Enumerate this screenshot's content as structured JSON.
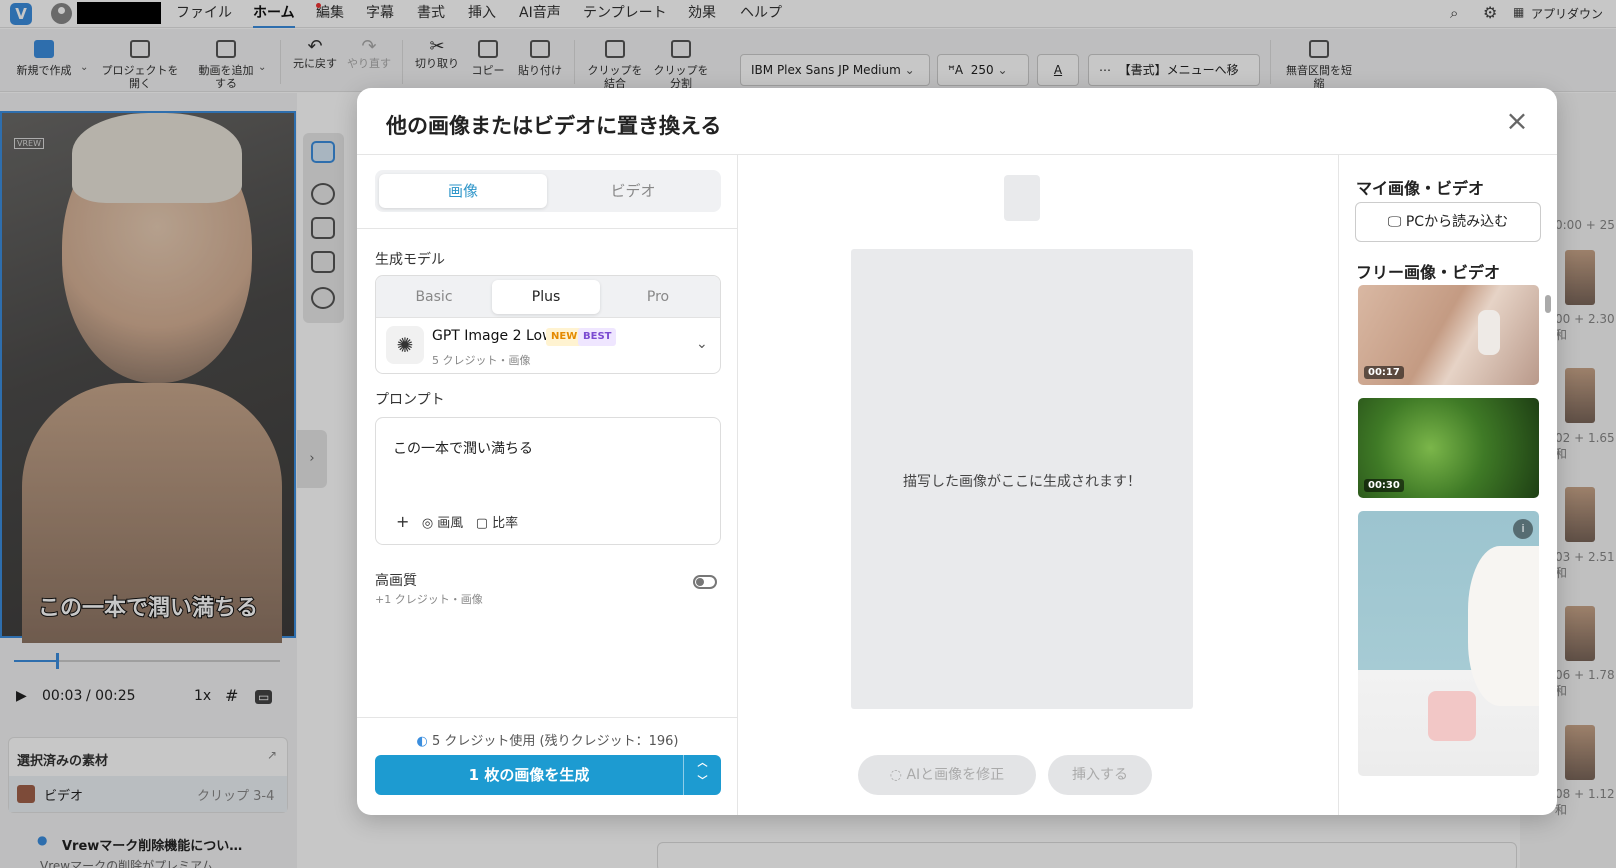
{
  "menubar": {
    "logo": "V",
    "items": [
      "ファイル",
      "ホーム",
      "編集",
      "字幕",
      "書式",
      "挿入",
      "AI音声",
      "テンプレート",
      "効果",
      "ヘルプ"
    ],
    "app_download": "アプリダウン"
  },
  "toolbar": {
    "new_create": "新規で作成",
    "open_project": "プロジェクトを開く",
    "add_video": "動画を追加する",
    "undo": "元に戻す",
    "redo": "やり直す",
    "cut": "切り取り",
    "copy": "コピー",
    "paste": "貼り付け",
    "merge_clip": "クリップを結合",
    "split_clip": "クリップを分割",
    "font_name": "IBM Plex Sans JP Medium",
    "font_size": "250",
    "format_menu": "【書式】メニューへ移動",
    "silence": "無音区間を短縮"
  },
  "player": {
    "subtitle": "この一本で潤い満ちる",
    "watermark": "VREW",
    "current_time": "00:03",
    "total_time": "/ 00:25",
    "speed": "1x",
    "progress": 0.16
  },
  "material": {
    "title": "選択済みの素材",
    "item_label": "ビデオ",
    "item_clip": "クリップ 3-4"
  },
  "notice": {
    "title": "Vrewマーク削除機能につい…",
    "body": "Vrewマークの削除がプレミアム…"
  },
  "background_right": {
    "timestamps": [
      "0:00 + 25",
      "00 + 2.30和",
      "02 + 1.65和",
      "03 + 2.51和",
      "06 + 1.78和",
      "08 + 1.12和"
    ]
  },
  "modal": {
    "title": "他の画像またはビデオに置き換える",
    "close": "×",
    "tabs": {
      "image": "画像",
      "video": "ビデオ"
    },
    "model_label": "生成モデル",
    "model_tiers": [
      "Basic",
      "Plus",
      "Pro"
    ],
    "model_name": "GPT Image 2 Low",
    "badge_new": "NEW",
    "badge_best": "BEST",
    "model_sub": "5 クレジット・画像",
    "prompt_label": "プロンプト",
    "prompt_text": "この一本で潤い満ちる",
    "prompt_tools": {
      "add": "+",
      "style": "画風",
      "ratio": "比率"
    },
    "hq_label": "高画質",
    "hq_sub": "+1 クレジット・画像",
    "hq_enabled": false,
    "credit_info": "5 クレジット使用 (残りクレジット：196)",
    "generate_button": "1 枚の画像を生成",
    "canvas_text": "描写した画像がここに生成されます！",
    "fix_button": "AIと画像を修正",
    "insert_button": "挿入する",
    "my_media_title": "マイ画像・ビデオ",
    "pc_button": "PCから読み込む",
    "free_media_title": "フリー画像・ビデオ",
    "thumb_durations": [
      "00:17",
      "00:30"
    ]
  }
}
